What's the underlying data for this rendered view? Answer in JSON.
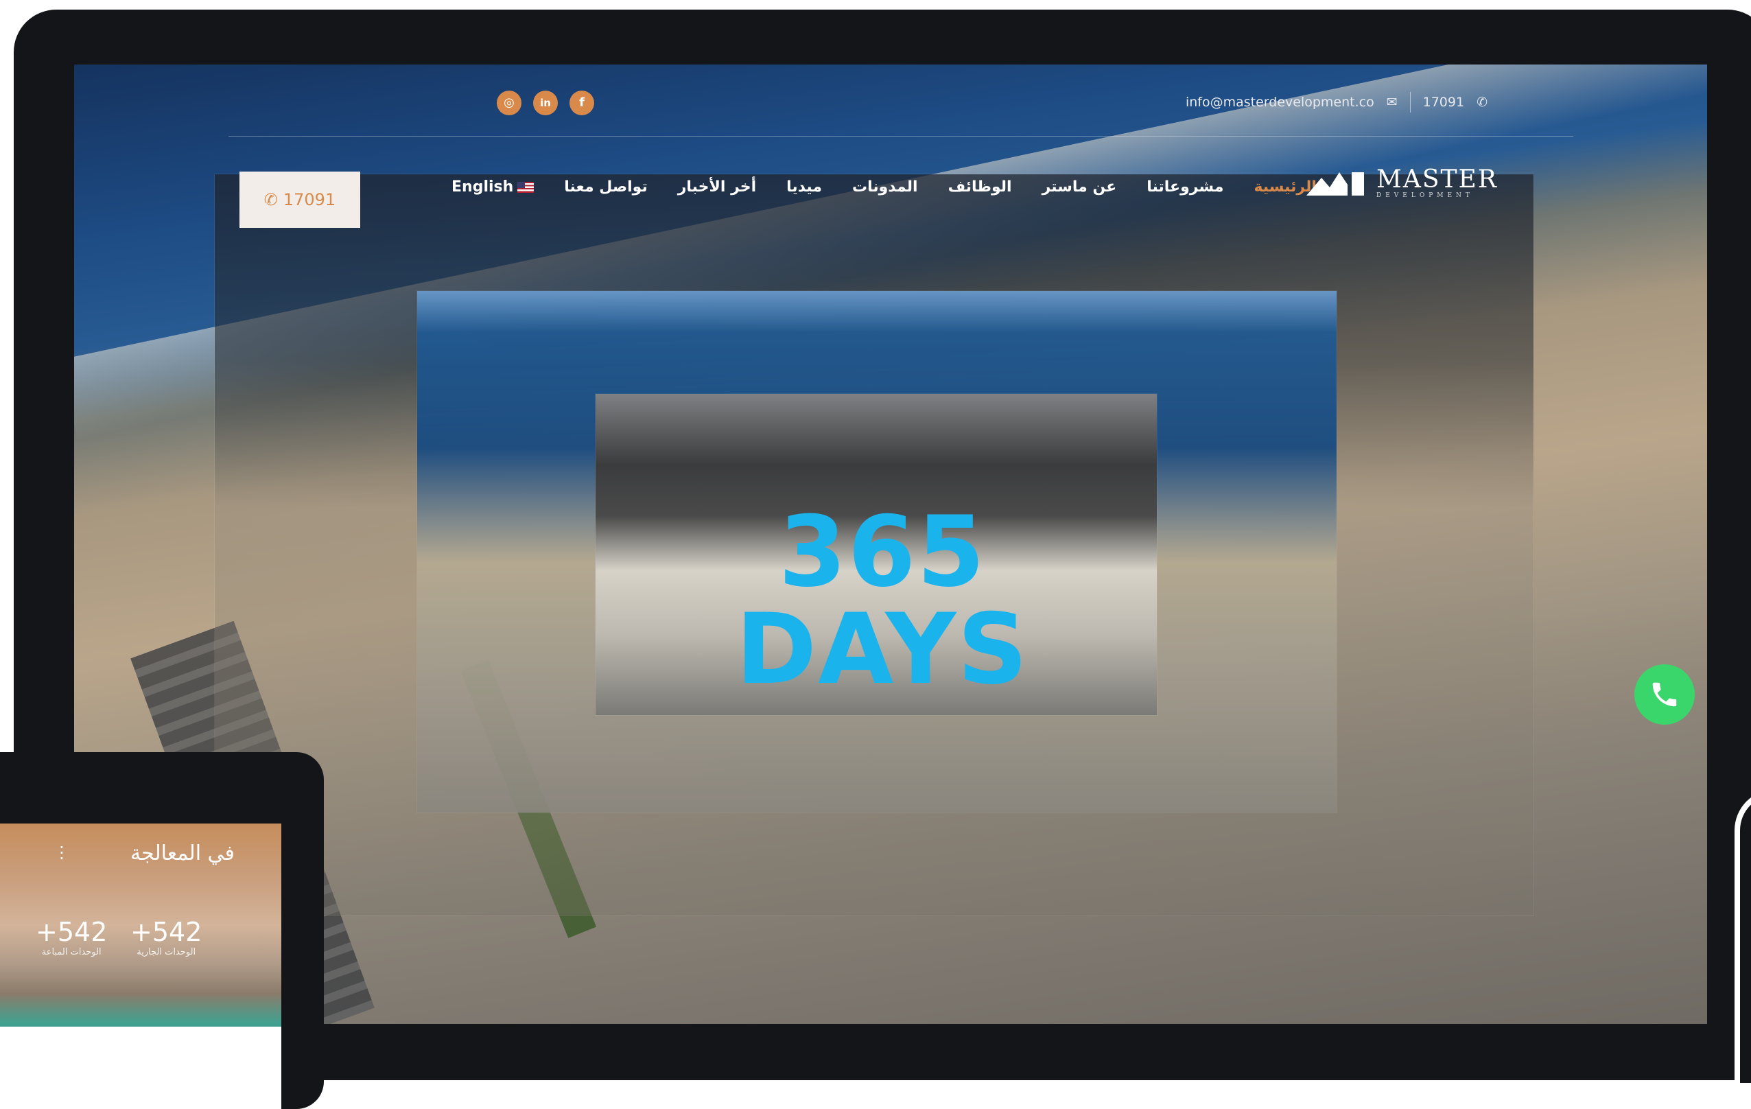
{
  "topbar": {
    "email": "info@masterdevelopment.co",
    "phone": "17091",
    "social": [
      {
        "icon": "instagram-icon",
        "glyph": "◎"
      },
      {
        "icon": "linkedin-icon",
        "glyph": "in"
      },
      {
        "icon": "facebook-icon",
        "glyph": "f"
      }
    ]
  },
  "nav": {
    "phone_button": "17091",
    "language": "English",
    "items": [
      {
        "label": "تواصل معنا"
      },
      {
        "label": "أخر الأخبار"
      },
      {
        "label": "ميديا"
      },
      {
        "label": "المدونات"
      },
      {
        "label": "الوظائف"
      },
      {
        "label": "عن ماستر"
      },
      {
        "label": "مشروعاتنا"
      },
      {
        "label": "الرئيسية"
      }
    ]
  },
  "logo": {
    "main": "MASTER",
    "sub": "DEVELOPMENT"
  },
  "hero": {
    "headline": "365 DAYS"
  },
  "tablet": {
    "title": "في المعالجة",
    "stats": [
      {
        "value": "+542",
        "label": "الوحدات المباعة"
      },
      {
        "value": "+542",
        "label": "الوحدات الجارية"
      }
    ]
  },
  "colors": {
    "accent": "#d98a4a",
    "headline": "#1ab3ec",
    "whatsapp": "#3ad66b"
  }
}
